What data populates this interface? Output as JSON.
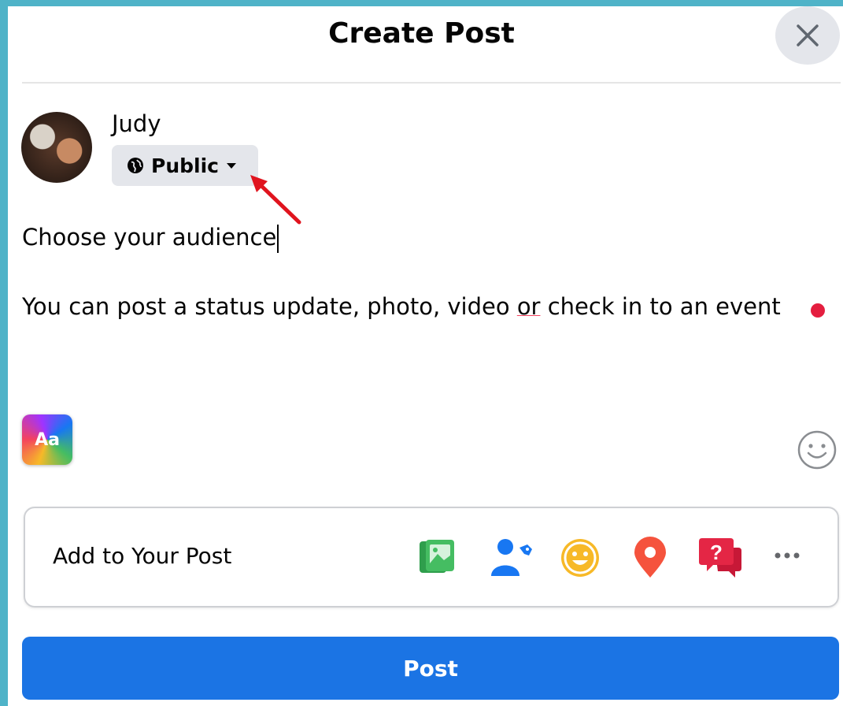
{
  "header": {
    "title": "Create Post"
  },
  "user": {
    "name": "Judy",
    "audience": "Public"
  },
  "composer": {
    "line1": "Choose your audience",
    "line2_before": "You can post a status update, photo, video ",
    "line2_underlined": "or",
    "line2_after": " check in to an event"
  },
  "format_button": {
    "label": "Aa"
  },
  "add_to_post": {
    "label": "Add to Your Post",
    "icons": [
      "photo-video-icon",
      "tag-people-icon",
      "feeling-activity-icon",
      "check-in-icon",
      "ask-question-icon",
      "more-icon"
    ]
  },
  "post_button": {
    "label": "Post"
  },
  "colors": {
    "accent": "#1b74e4",
    "photo": "#45bd62",
    "tag": "#1877f2",
    "feeling": "#f7b928",
    "checkin": "#f5533d",
    "question": "#e42645"
  }
}
